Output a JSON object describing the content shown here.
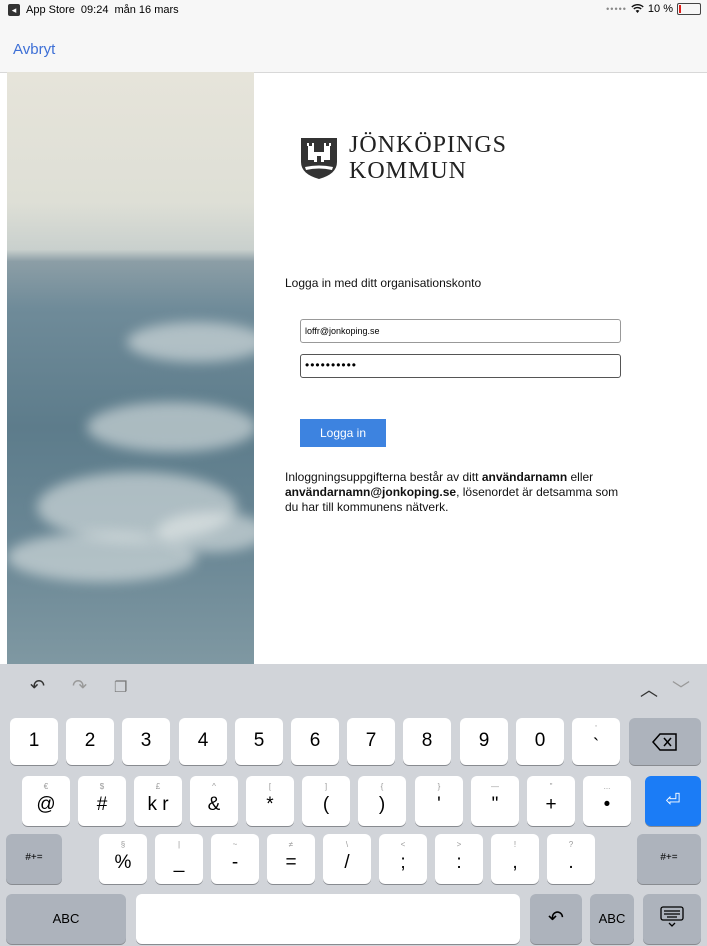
{
  "status_bar": {
    "back_app": "App Store",
    "time": "09:24",
    "date": "mån 16 mars",
    "battery_percent": "10 %",
    "battery_level": 0.1
  },
  "nav": {
    "cancel_label": "Avbryt"
  },
  "logo": {
    "line1": "JÖNKÖPINGS",
    "line2": "KOMMUN"
  },
  "login": {
    "heading": "Logga in med ditt organisationskonto",
    "username_value": "loffr@jonkoping.se",
    "password_value": "••••••••••",
    "button_label": "Logga in",
    "info_prefix": "Inloggningsuppgifterna består av ditt ",
    "info_bold1": "användarnamn",
    "info_mid": " eller ",
    "info_bold2": "användarnamn@jonkoping.se",
    "info_suffix": ", lösenordet är detsamma som du har till kommunens nätverk."
  },
  "keyboard": {
    "row1": [
      {
        "main": "1",
        "sub": ""
      },
      {
        "main": "2",
        "sub": ""
      },
      {
        "main": "3",
        "sub": ""
      },
      {
        "main": "4",
        "sub": ""
      },
      {
        "main": "5",
        "sub": ""
      },
      {
        "main": "6",
        "sub": ""
      },
      {
        "main": "7",
        "sub": ""
      },
      {
        "main": "8",
        "sub": ""
      },
      {
        "main": "9",
        "sub": ""
      },
      {
        "main": "0",
        "sub": ""
      },
      {
        "main": "`",
        "sub": "'"
      }
    ],
    "row2": [
      {
        "main": "@",
        "sub": "€"
      },
      {
        "main": "#",
        "sub": "$"
      },
      {
        "main": "k r",
        "sub": "£"
      },
      {
        "main": "&",
        "sub": "^"
      },
      {
        "main": "*",
        "sub": "["
      },
      {
        "main": "(",
        "sub": "]"
      },
      {
        "main": ")",
        "sub": "{"
      },
      {
        "main": "'",
        "sub": "}"
      },
      {
        "main": "\"",
        "sub": "—"
      },
      {
        "main": "+",
        "sub": "\""
      },
      {
        "main": "•",
        "sub": "..."
      }
    ],
    "row3": [
      {
        "main": "%",
        "sub": "§"
      },
      {
        "main": "_",
        "sub": "|"
      },
      {
        "main": "-",
        "sub": "~"
      },
      {
        "main": "=",
        "sub": "≠"
      },
      {
        "main": "/",
        "sub": "\\"
      },
      {
        "main": ";",
        "sub": "<"
      },
      {
        "main": ":",
        "sub": ">"
      },
      {
        "main": ",",
        "sub": "!"
      },
      {
        "main": ".",
        "sub": "?"
      }
    ],
    "shift_left_label": "#+=",
    "shift_right_label": "#+=",
    "abc_left_label": "ABC",
    "abc_right_label": "ABC"
  }
}
